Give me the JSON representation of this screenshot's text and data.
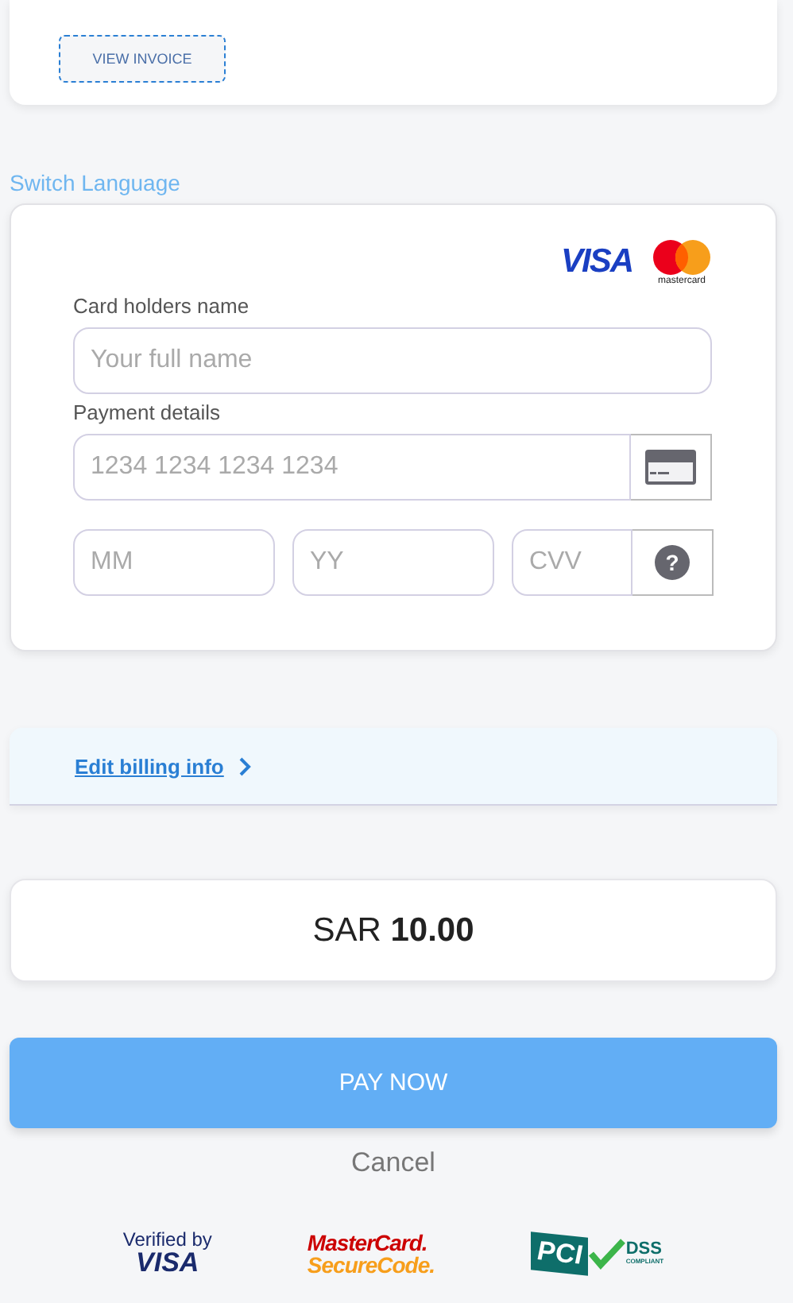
{
  "invoice": {
    "button": "VIEW INVOICE"
  },
  "switch_language": "Switch Language",
  "card_form": {
    "brand_logos": {
      "visa": "VISA",
      "mastercard": "mastercard"
    },
    "holder_label": "Card holders name",
    "holder_placeholder": "Your full name",
    "payment_label": "Payment details",
    "number_placeholder": "1234 1234 1234 1234",
    "month_placeholder": "MM",
    "year_placeholder": "YY",
    "cvv_placeholder": "CVV",
    "help_icon": "?"
  },
  "billing": {
    "link": "Edit billing info"
  },
  "amount": {
    "currency": "SAR",
    "value": "10.00"
  },
  "pay_button": "PAY NOW",
  "cancel": "Cancel",
  "trust_badges": [
    {
      "kind": "verified",
      "lines": [
        "Verified by",
        "VISA"
      ]
    },
    {
      "kind": "securecode",
      "lines": [
        "MasterCard.",
        "SecureCode."
      ]
    },
    {
      "kind": "pci",
      "lines": [
        "PCI",
        "DSS",
        "COMPLIANT"
      ]
    }
  ]
}
